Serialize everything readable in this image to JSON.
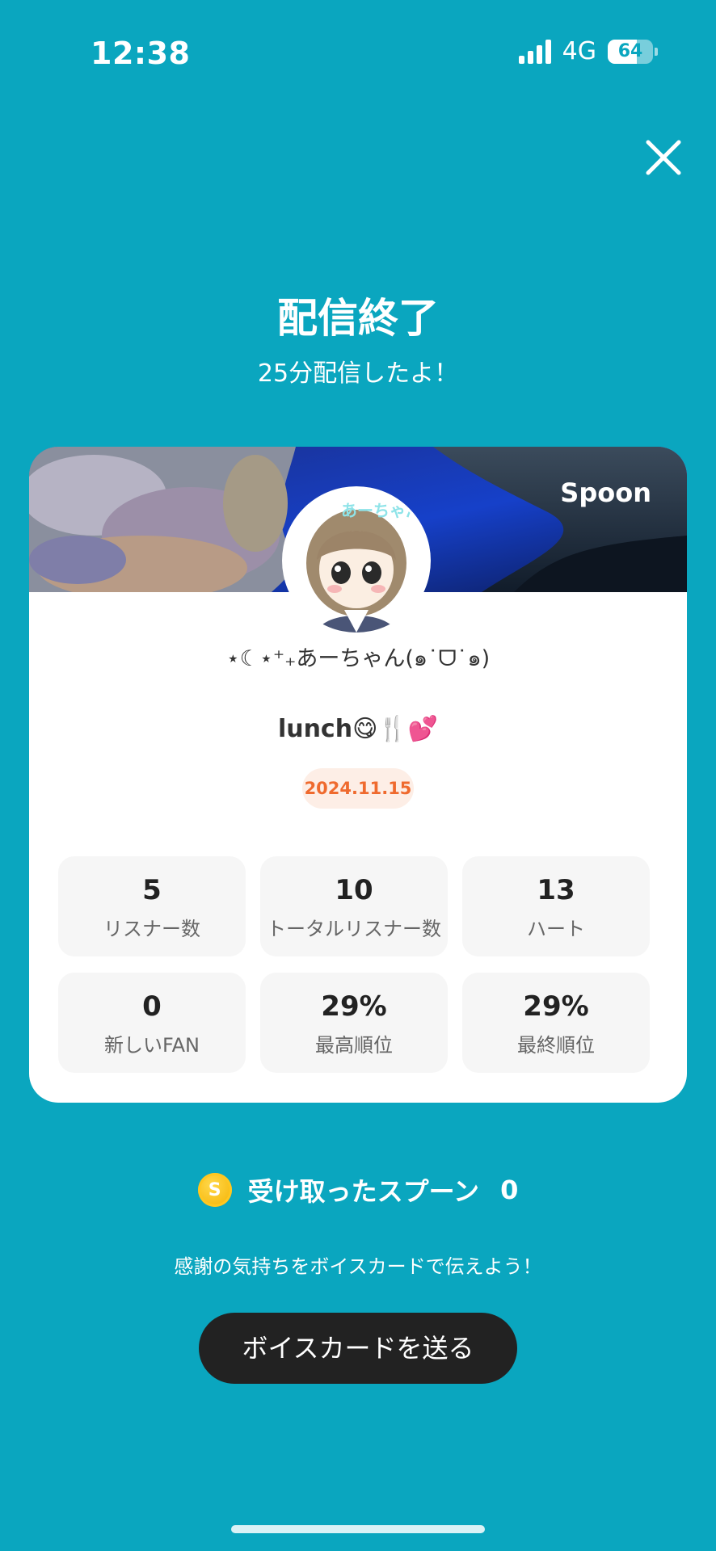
{
  "status_bar": {
    "time": "12:38",
    "network": "4G",
    "battery": "64",
    "battery_level": 0.64
  },
  "header": {
    "title": "配信終了",
    "subtitle": "25分配信したよ！"
  },
  "card": {
    "logo": "Spoon",
    "username": "⋆☾⋆⁺₊あーちゃん(๑˙ᗜ˙๑)",
    "live_title": "lunch😋🍴💕",
    "date": "2024.11.15",
    "stats": [
      {
        "value": "5",
        "label": "リスナー数"
      },
      {
        "value": "10",
        "label": "トータルリスナー数"
      },
      {
        "value": "13",
        "label": "ハート"
      },
      {
        "value": "0",
        "label": "新しいFAN"
      },
      {
        "value": "29%",
        "label": "最高順位"
      },
      {
        "value": "29%",
        "label": "最終順位"
      }
    ]
  },
  "spoons": {
    "coin_letter": "S",
    "label": "受け取ったスプーン",
    "count": "0"
  },
  "thanks_text": "感謝の気持ちをボイスカードで伝えよう！",
  "voice_card_button": "ボイスカードを送る",
  "colors": {
    "background": "#0aa6bf",
    "card": "#ffffff",
    "date_badge_text": "#ef6a2e",
    "button": "#222222"
  }
}
